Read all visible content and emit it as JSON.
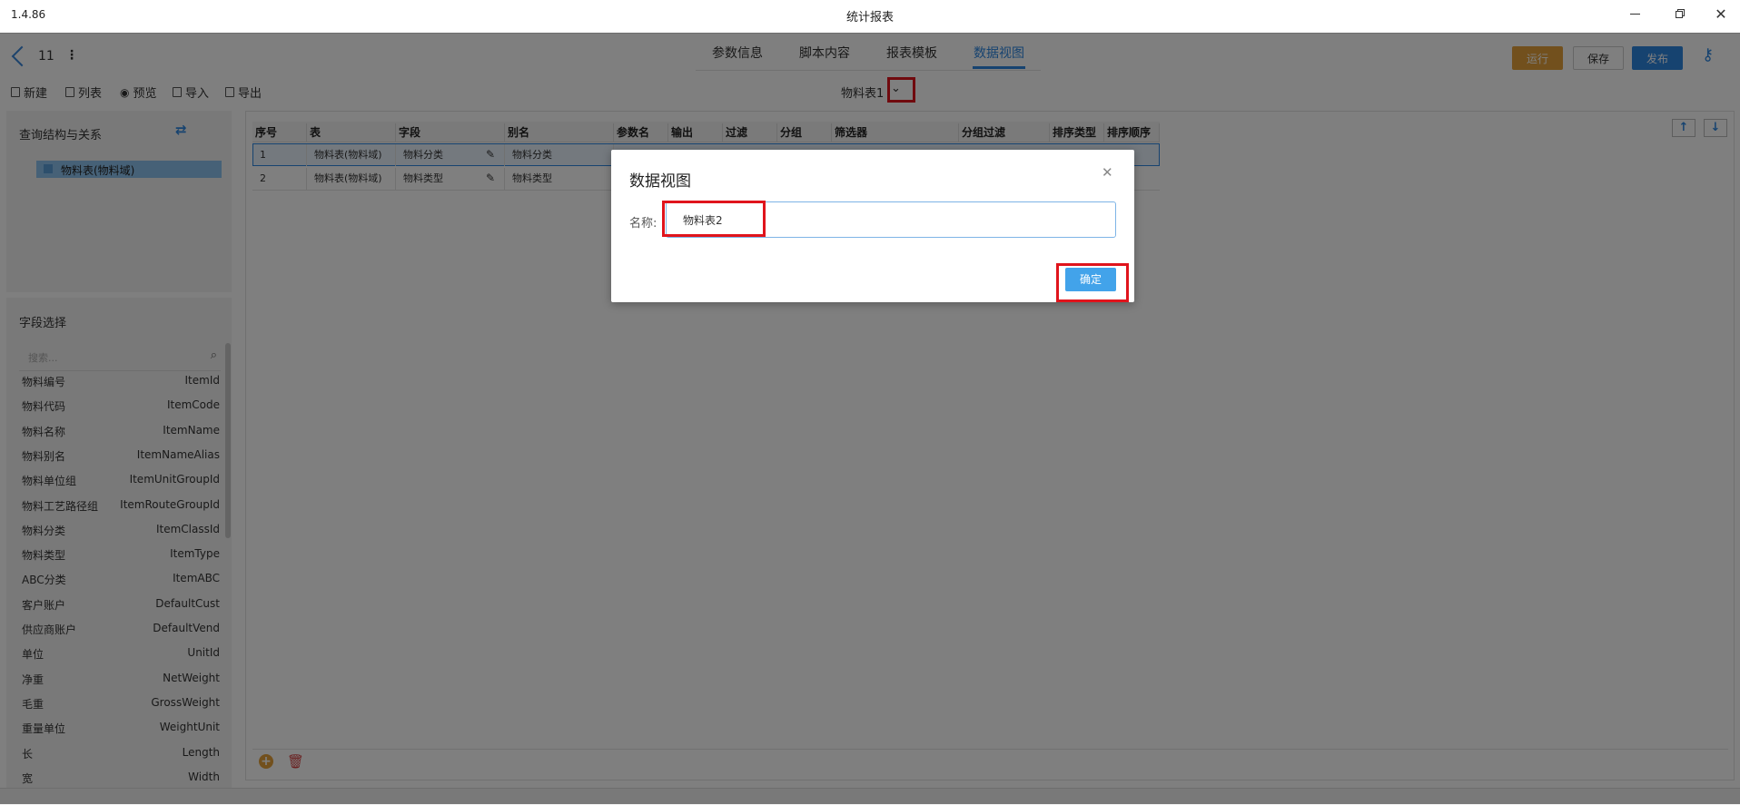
{
  "window": {
    "version": "1.4.86",
    "title": "统计报表"
  },
  "header": {
    "record_no": "11",
    "tabs": [
      {
        "label": "参数信息",
        "active": false
      },
      {
        "label": "脚本内容",
        "active": false
      },
      {
        "label": "报表模板",
        "active": false
      },
      {
        "label": "数据视图",
        "active": true
      }
    ],
    "buttons": {
      "run": "运行",
      "save": "保存",
      "publish": "发布"
    },
    "accent": "#2d86e0",
    "run_color": "#e4a13a"
  },
  "toolbar": {
    "items": [
      "新建",
      "列表",
      "预览",
      "导入",
      "导出"
    ],
    "view_selector": "物料表1"
  },
  "left": {
    "query_title": "查询结构与关系",
    "tree_item": "物料表(物料域)",
    "fields_title": "字段选择",
    "search_placeholder": "搜索...",
    "fields": [
      {
        "cn": "物料编号",
        "en": "ItemId"
      },
      {
        "cn": "物料代码",
        "en": "ItemCode"
      },
      {
        "cn": "物料名称",
        "en": "ItemName"
      },
      {
        "cn": "物料别名",
        "en": "ItemNameAlias"
      },
      {
        "cn": "物料单位组",
        "en": "ItemUnitGroupId"
      },
      {
        "cn": "物料工艺路径组",
        "en": "ItemRouteGroupId"
      },
      {
        "cn": "物料分类",
        "en": "ItemClassId"
      },
      {
        "cn": "物料类型",
        "en": "ItemType"
      },
      {
        "cn": "ABC分类",
        "en": "ItemABC"
      },
      {
        "cn": "客户账户",
        "en": "DefaultCust"
      },
      {
        "cn": "供应商账户",
        "en": "DefaultVend"
      },
      {
        "cn": "单位",
        "en": "UnitId"
      },
      {
        "cn": "净重",
        "en": "NetWeight"
      },
      {
        "cn": "毛重",
        "en": "GrossWeight"
      },
      {
        "cn": "重量单位",
        "en": "WeightUnit"
      },
      {
        "cn": "长",
        "en": "Length"
      },
      {
        "cn": "宽",
        "en": "Width"
      }
    ]
  },
  "grid": {
    "columns": [
      "序号",
      "表",
      "字段",
      "别名",
      "参数名",
      "输出",
      "过滤",
      "分组",
      "筛选器",
      "分组过滤",
      "排序类型",
      "排序顺序"
    ],
    "rows": [
      {
        "no": "1",
        "table": "物料表(物料域)",
        "field": "物料分类",
        "alias": "物料分类"
      },
      {
        "no": "2",
        "table": "物料表(物料域)",
        "field": "物料类型",
        "alias": "物料类型"
      }
    ]
  },
  "dialog": {
    "title": "数据视图",
    "name_label": "名称:",
    "name_value": "物料表2",
    "ok_label": "确定"
  }
}
